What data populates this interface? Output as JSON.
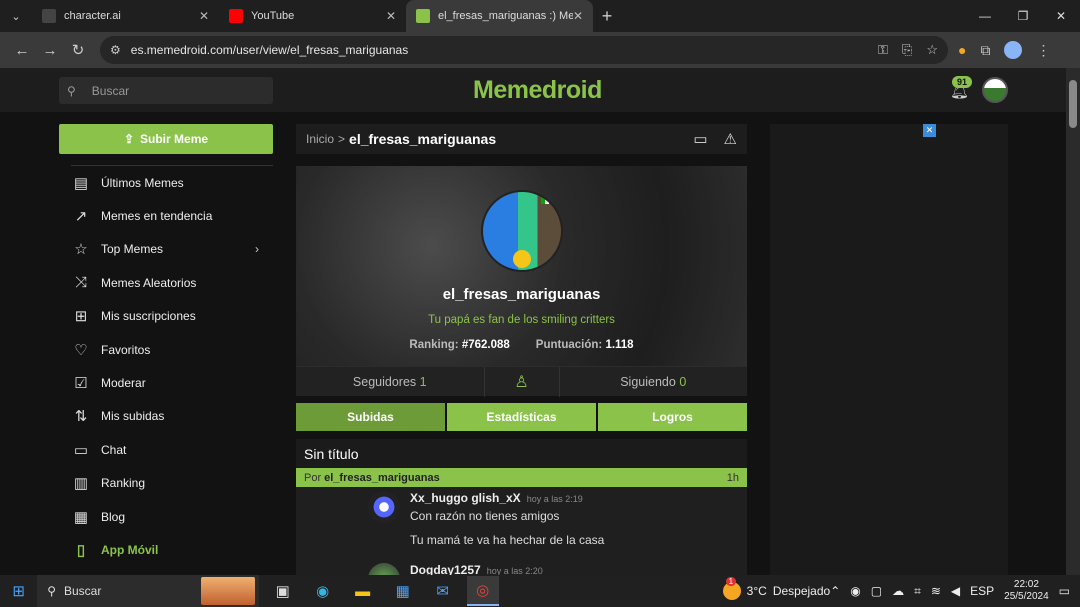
{
  "browser": {
    "tabs": [
      {
        "title": "character.ai",
        "fav_color": "#444444",
        "active": false
      },
      {
        "title": "YouTube",
        "fav_color": "#ff0000",
        "active": false
      },
      {
        "title": "el_fresas_mariguanas :) Memedroid",
        "fav_color": "#8bc34a",
        "active": true
      }
    ],
    "url": "es.memedroid.com/user/view/el_fresas_mariguanas"
  },
  "site": {
    "search_placeholder": "Buscar",
    "logo": "Memedroid",
    "notifications_count": "91",
    "upload_label": "Subir Meme",
    "nav": [
      {
        "label": "Últimos Memes",
        "icon": "latest-icon",
        "glyph": "▤"
      },
      {
        "label": "Memes en tendencia",
        "icon": "trending-icon",
        "glyph": "↗"
      },
      {
        "label": "Top Memes",
        "icon": "star-icon",
        "glyph": "☆"
      },
      {
        "label": "Memes Aleatorios",
        "icon": "shuffle-icon",
        "glyph": "⤨"
      },
      {
        "label": "Mis suscripciones",
        "icon": "subscriptions-icon",
        "glyph": "⊞"
      },
      {
        "label": "Favoritos",
        "icon": "heart-icon",
        "glyph": "♡"
      },
      {
        "label": "Moderar",
        "icon": "moderate-icon",
        "glyph": "☑"
      },
      {
        "label": "Mis subidas",
        "icon": "uploads-icon",
        "glyph": "⇅"
      },
      {
        "label": "Chat",
        "icon": "chat-icon",
        "glyph": "▭"
      },
      {
        "label": "Ranking",
        "icon": "ranking-icon",
        "glyph": "▥"
      },
      {
        "label": "Blog",
        "icon": "blog-icon",
        "glyph": "▦"
      },
      {
        "label": "App Móvil",
        "icon": "mobile-icon",
        "glyph": "▯"
      }
    ]
  },
  "profile": {
    "breadcrumb_home": "Inicio",
    "breadcrumb_sep": ">",
    "breadcrumb_user": "el_fresas_mariguanas",
    "username": "el_fresas_mariguanas",
    "bio": "Tu papá es fan de los smiling critters",
    "ranking_label": "Ranking:",
    "ranking_value": "#762.088",
    "score_label": "Puntuación:",
    "score_value": "1.118",
    "followers_label": "Seguidores",
    "followers_count": "1",
    "following_label": "Siguiendo",
    "following_count": "0",
    "tabs": [
      "Subidas",
      "Estadísticas",
      "Logros"
    ]
  },
  "post": {
    "title": "Sin título",
    "by_label": "Por",
    "author": "el_fresas_mariguanas",
    "age": "1h",
    "comments": [
      {
        "user": "Xx_huggo glish_xX",
        "time": "hoy a las 2:19",
        "lines": [
          "Con razón no tienes amigos",
          "Tu mamá te va ha hechar de la casa"
        ]
      },
      {
        "user": "Dogday1257",
        "time": "hoy a las 2:20",
        "lines": []
      }
    ]
  },
  "taskbar": {
    "search": "Buscar",
    "weather_temp": "3°C",
    "weather_text": "Despejado",
    "weather_badge": "1",
    "lang": "ESP",
    "time": "22:02",
    "date": "25/5/2024"
  }
}
